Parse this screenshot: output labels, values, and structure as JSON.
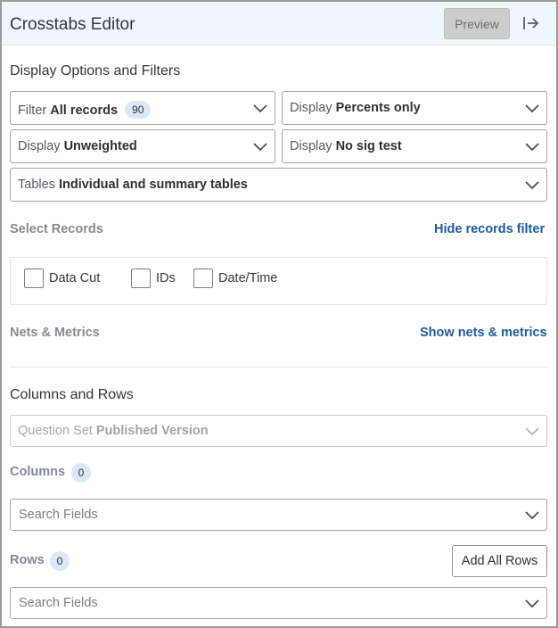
{
  "header": {
    "title": "Crosstabs Editor",
    "preview_label": "Preview"
  },
  "display_options": {
    "title": "Display Options and Filters",
    "filter": {
      "label": "Filter",
      "value": "All records",
      "count": "90"
    },
    "display_percents": {
      "label": "Display",
      "value": "Percents only"
    },
    "display_weight": {
      "label": "Display",
      "value": "Unweighted"
    },
    "display_sig": {
      "label": "Display",
      "value": "No sig test"
    },
    "tables": {
      "label": "Tables",
      "value": "Individual and summary tables"
    }
  },
  "select_records": {
    "title": "Select Records",
    "toggle_link": "Hide records filter",
    "checkboxes": [
      {
        "label": "Data Cut",
        "checked": false
      },
      {
        "label": "IDs",
        "checked": false
      },
      {
        "label": "Date/Time",
        "checked": false
      }
    ]
  },
  "nets_metrics": {
    "title": "Nets & Metrics",
    "toggle_link": "Show nets & metrics"
  },
  "columns_rows": {
    "title": "Columns and Rows",
    "question_set": {
      "label": "Question Set",
      "value": "Published Version"
    },
    "columns": {
      "label": "Columns",
      "count": "0",
      "search_placeholder": "Search Fields"
    },
    "rows": {
      "label": "Rows",
      "count": "0",
      "search_placeholder": "Search Fields",
      "add_all_label": "Add All Rows"
    }
  },
  "colors": {
    "accent_link": "#1d5d9c",
    "badge_bg": "#dbe8f7",
    "header_bg": "#f0f6fd"
  },
  "icons": {
    "collapse": "collapse-right-icon",
    "dropdown": "chevron-down-icon"
  }
}
